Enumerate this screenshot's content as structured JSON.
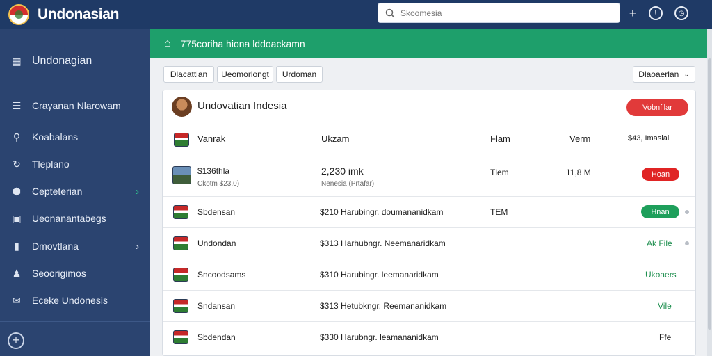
{
  "app": {
    "title": "Undonasian"
  },
  "search": {
    "placeholder": "Skoomesia"
  },
  "topbar": {
    "icons": [
      "plus-icon",
      "info-icon",
      "clock-icon"
    ]
  },
  "sidebar": {
    "items": [
      {
        "label": "Undonagian",
        "icon": "grid-icon"
      },
      {
        "label": "Crayanan Nlarowam",
        "icon": "list-icon"
      },
      {
        "label": "Koabalans",
        "icon": "search-icon"
      },
      {
        "label": "Tleplano",
        "icon": "refresh-icon"
      },
      {
        "label": "Cepteterian",
        "icon": "cube-icon",
        "chevron": true
      },
      {
        "label": "Ueonanantabegs",
        "icon": "image-icon"
      },
      {
        "label": "Dmovtlana",
        "icon": "book-icon",
        "chevron": true
      },
      {
        "label": "Seoorigimos",
        "icon": "people-icon"
      },
      {
        "label": "Eceke Undonesis",
        "icon": "mail-icon"
      }
    ]
  },
  "breadcrumb": {
    "title": "775coriha hiona lddoackamn"
  },
  "filters": [
    {
      "label": "Dlacattlan"
    },
    {
      "label": "Ueomorlongt"
    },
    {
      "label": "Urdoman"
    }
  ],
  "dropdown": {
    "label": "Dlaoaerlan"
  },
  "card": {
    "title": "Undovatian Indesia",
    "action_label": "Vobnfllar"
  },
  "table": {
    "headers": [
      "Vanrak",
      "Ukzam",
      "Flam",
      "Verm",
      "$43, Imasiai"
    ],
    "rows": [
      {
        "name": "$136thla",
        "sub": "Ckotm $23.0)",
        "col2": "2,230 imk",
        "col2sub": "Nenesia (Prtafar)",
        "col3": "Tlem",
        "col4": "11,8 M",
        "status": "Hoan",
        "status_kind": "red"
      },
      {
        "name": "Sbdensan",
        "col2": "$210 Harubingr. doumananidkam",
        "col3": "TEM",
        "status": "Hnan",
        "status_kind": "green"
      },
      {
        "name": "Undondan",
        "col2": "$313 Harhubngr. Neemanaridkam",
        "status": "Ak File",
        "status_kind": "text"
      },
      {
        "name": "Sncoodsams",
        "col2": "$310 Harubingr. leemanaridkam",
        "status": "Ukoaers",
        "status_kind": "text"
      },
      {
        "name": "Sndansan",
        "col2": "$313 Hetubkngr. Reemananidkam",
        "status": "Vile",
        "status_kind": "text"
      },
      {
        "name": "Sbdendan",
        "col2": "$330 Harubngr. leamananidkam",
        "status": "Ffe",
        "status_kind": "plain"
      }
    ]
  },
  "colors": {
    "topbar": "#1f3a66",
    "sidebar": "#2b4470",
    "green": "#1e9f6b",
    "red": "#e13a3a"
  }
}
